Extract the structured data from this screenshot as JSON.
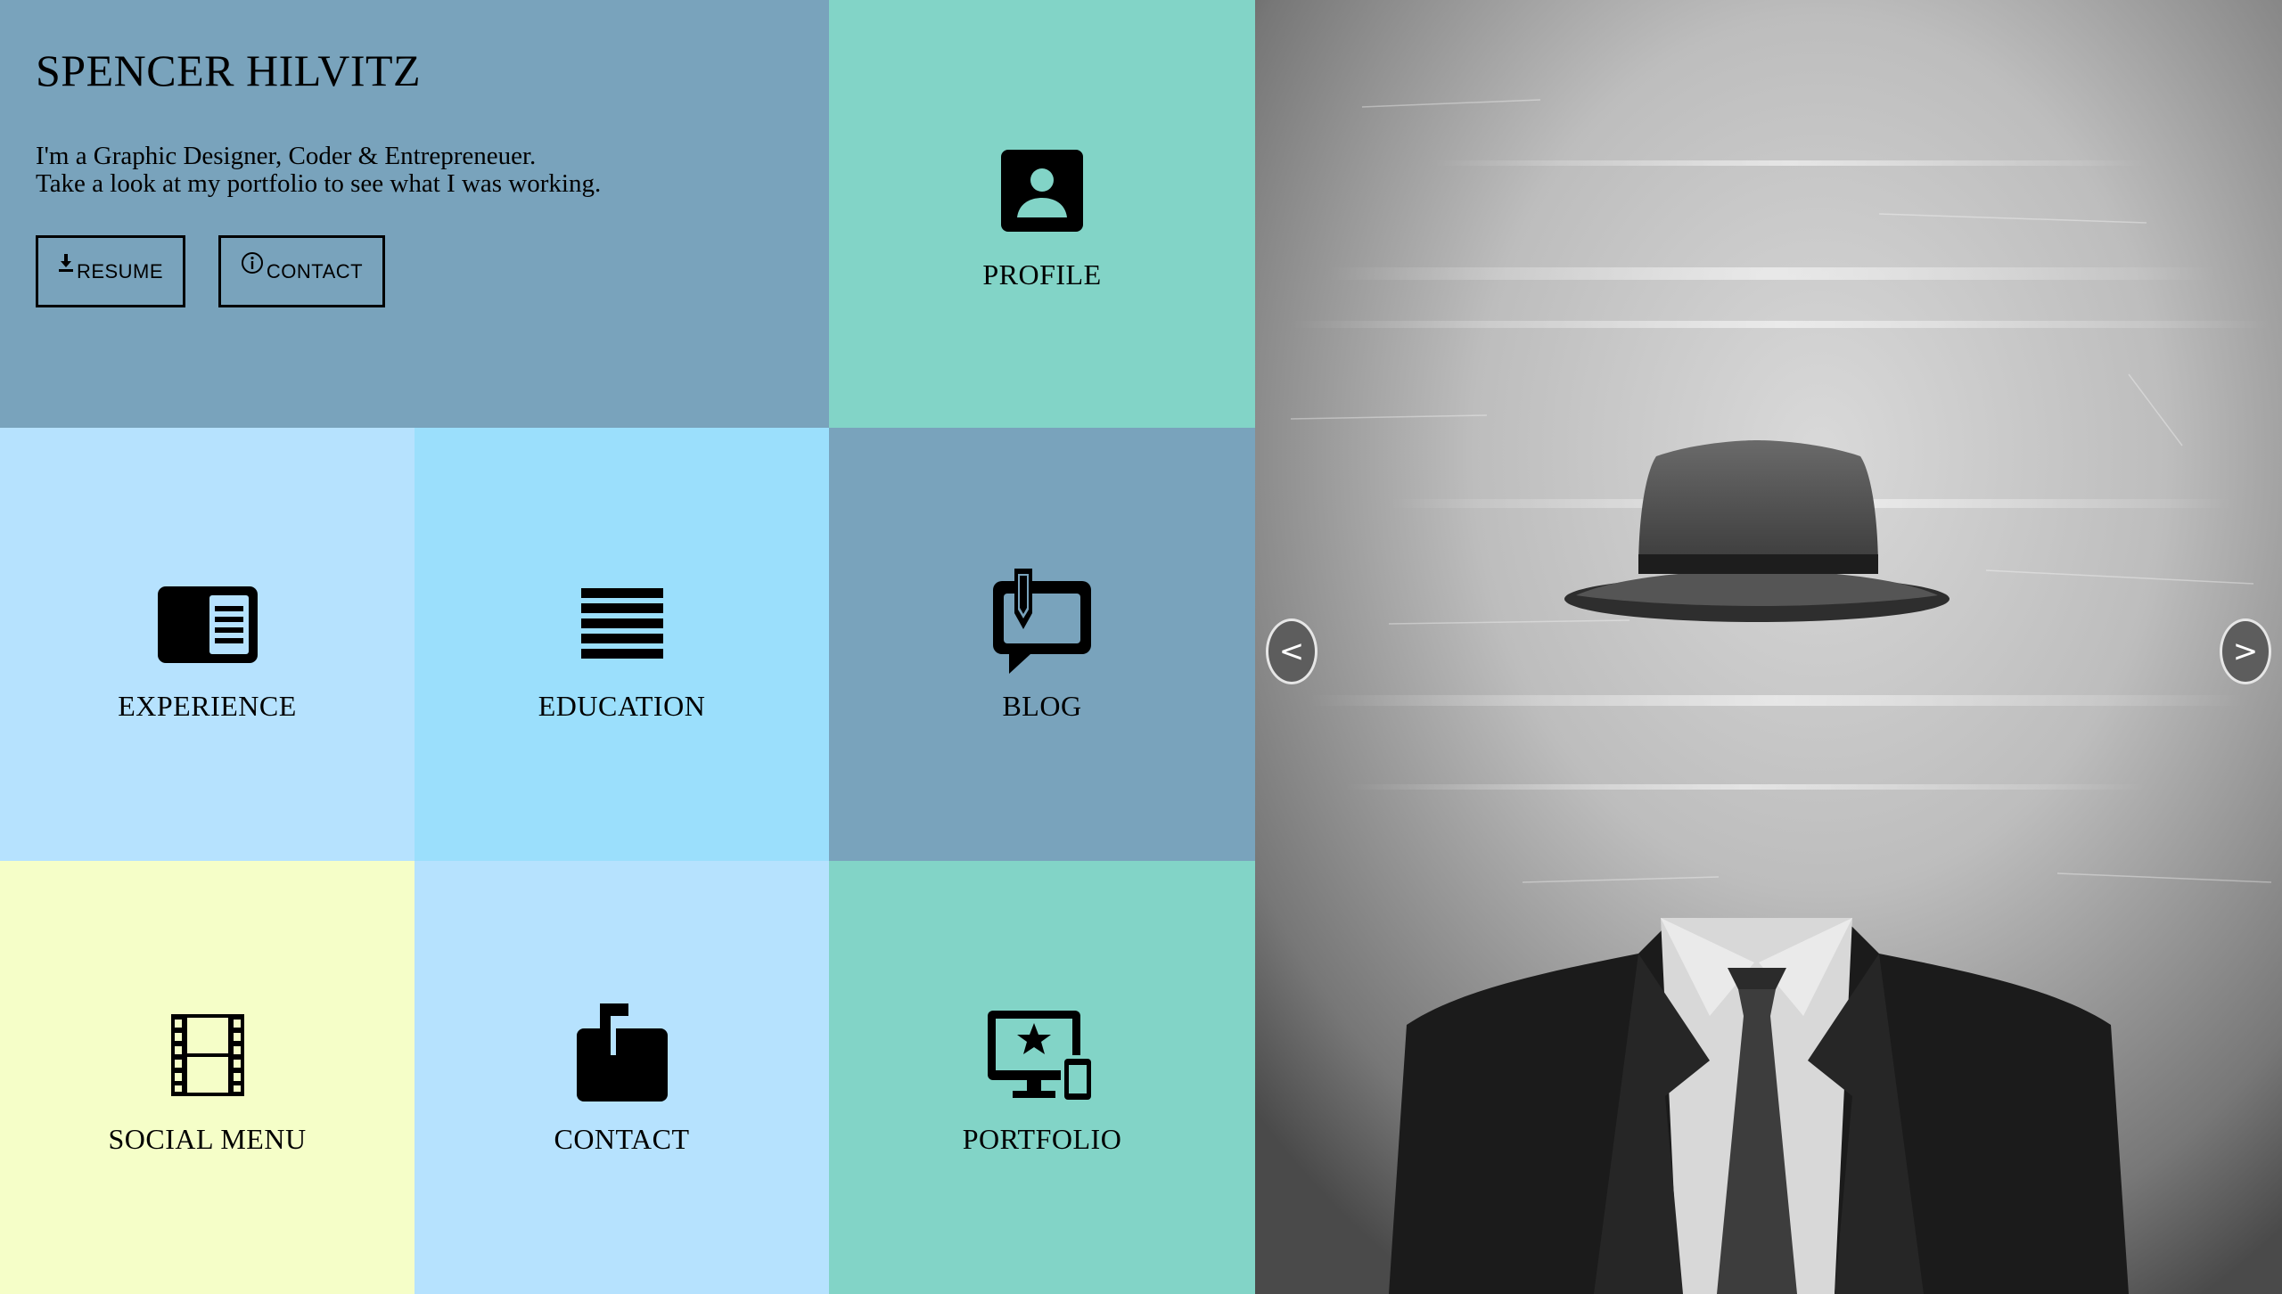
{
  "header": {
    "name": "SPENCER HILVITZ",
    "tagline_line1": "I'm a Graphic Designer, Coder & Entrepreneuer.",
    "tagline_line2": "Take a look at my portfolio to see what I was working.",
    "resume_label": "RESUME",
    "contact_label": "CONTACT"
  },
  "tiles": {
    "profile": "PROFILE",
    "experience": "EXPERIENCE",
    "education": "EDUCATION",
    "blog": "BLOG",
    "social_menu": "SOCIAL MENU",
    "contact": "CONTACT",
    "portfolio": "PORTFOLIO"
  },
  "slider": {
    "prev_label": "<",
    "next_label": ">"
  },
  "colors": {
    "steel_blue": "#79a3bc",
    "mint": "#82d4c7",
    "pale_blue": "#b6e2fe",
    "sky_blue": "#9bdffc",
    "pale_yellow": "#f5fec8"
  },
  "icons": {
    "resume": "download-icon",
    "contact_button": "info-icon",
    "profile": "user-card-icon",
    "experience": "newspaper-icon",
    "education": "lines-icon",
    "blog": "chat-pen-icon",
    "social_menu": "film-icon",
    "contact": "mailbox-icon",
    "portfolio": "devices-star-icon"
  }
}
